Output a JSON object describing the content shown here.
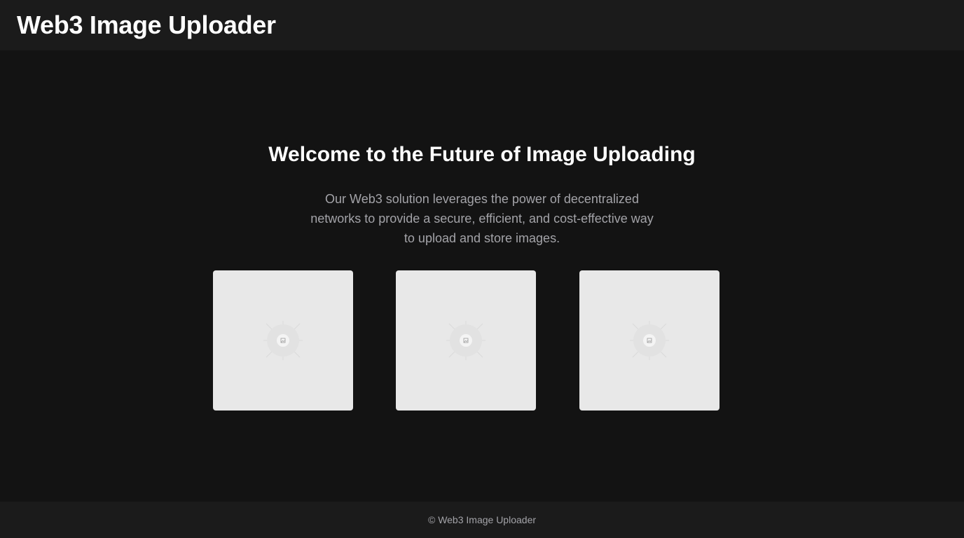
{
  "header": {
    "title": "Web3 Image Uploader"
  },
  "hero": {
    "title": "Welcome to the Future of Image Uploading",
    "description": "Our Web3 solution leverages the power of decentralized networks to provide a secure, efficient, and cost-effective way to upload and store images."
  },
  "gallery": {
    "items": [
      {
        "icon": "image-placeholder-icon"
      },
      {
        "icon": "image-placeholder-icon"
      },
      {
        "icon": "image-placeholder-icon"
      }
    ]
  },
  "footer": {
    "text": "© Web3 Image Uploader"
  },
  "colors": {
    "background": "#131313",
    "header_footer": "#1b1b1b",
    "placeholder": "#e8e8e8",
    "muted_text": "#a3a3a8"
  }
}
